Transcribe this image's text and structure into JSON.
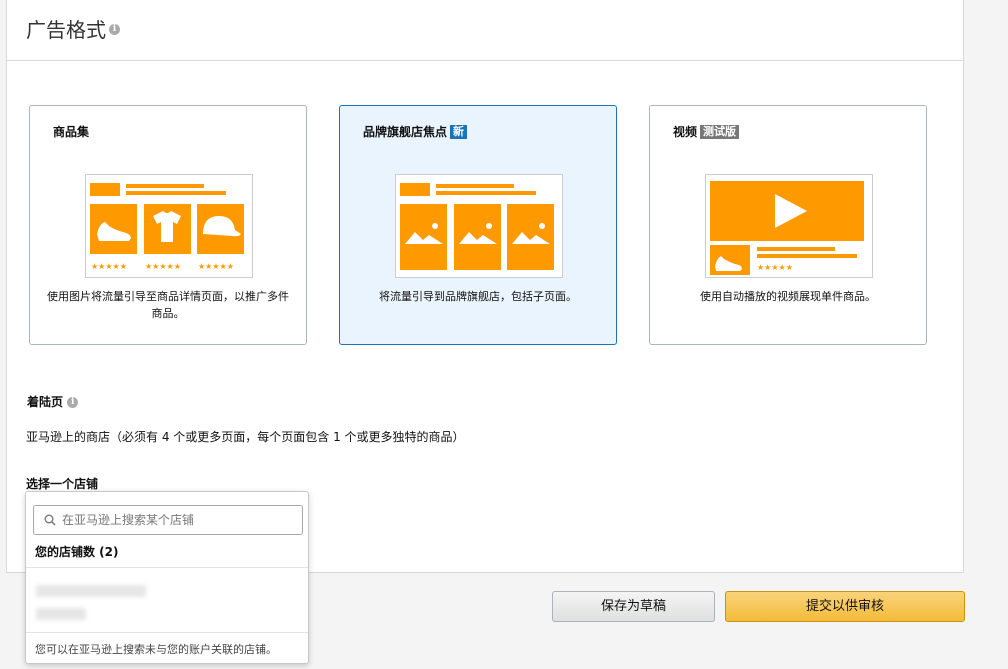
{
  "section": {
    "title": "广告格式"
  },
  "formats": [
    {
      "title": "商品集",
      "badge": "",
      "description": "使用图片将流量引导至商品详情页面，以推广多件商品。",
      "selected": false
    },
    {
      "title": "品牌旗舰店焦点",
      "badge": "新",
      "description": "将流量引导到品牌旗舰店，包括子页面。",
      "selected": true
    },
    {
      "title": "视频",
      "badge": "测试版",
      "description": "使用自动播放的视频展现单件商品。",
      "selected": false
    }
  ],
  "landing": {
    "label": "着陆页",
    "text": "亚马逊上的商店（必须有 4 个或更多页面，每个页面包含 1 个或更多独特的商品）"
  },
  "store_select": {
    "label": "选择一个店铺",
    "search_placeholder": "在亚马逊上搜索某个店铺",
    "count_label": "您的店铺数 (2)",
    "footer": "您可以在亚马逊上搜索未与您的账户关联的店铺。"
  },
  "actions": {
    "draft_label": "保存为草稿",
    "submit_label": "提交以供审核"
  },
  "colors": {
    "accent_orange": "#ff9900",
    "selected_blue": "#1a74b7",
    "submit_yellow": "#f4bb3a"
  },
  "icons": [
    "info-icon",
    "search-icon",
    "shoe-icon",
    "tshirt-icon",
    "cap-icon",
    "image-icon",
    "play-icon",
    "star-icon"
  ]
}
